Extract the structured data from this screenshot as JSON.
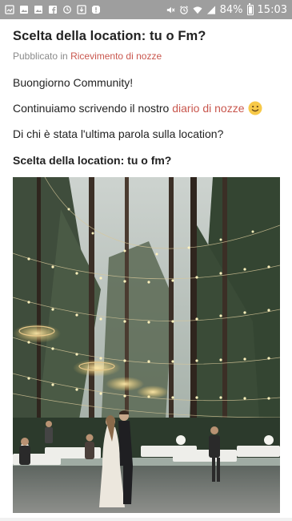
{
  "status_bar": {
    "battery": "84%",
    "time": "15:03",
    "left_icons": [
      "gallery-icon",
      "image-icon",
      "image-icon",
      "facebook-icon",
      "sync-icon",
      "download-icon",
      "alert-icon"
    ],
    "right_icons": [
      "mute-icon",
      "alarm-icon",
      "wifi-icon",
      "signal-icon",
      "battery-icon"
    ]
  },
  "post": {
    "title": "Scelta della location: tu o Fm?",
    "published_prefix": "Pubblicato in",
    "category_link": "Ricevimento di nozze",
    "greeting": "Buongiorno Community!",
    "continue_text": "Continuiamo scrivendo il nostro",
    "diary_link": "diario di nozze",
    "question": "Di chi è stata l'ultima parola sulla location?",
    "subheading": "Scelta della location: tu o fm?"
  },
  "colors": {
    "accent_link": "#c9574e",
    "status_bar": "#9e9e9e"
  }
}
